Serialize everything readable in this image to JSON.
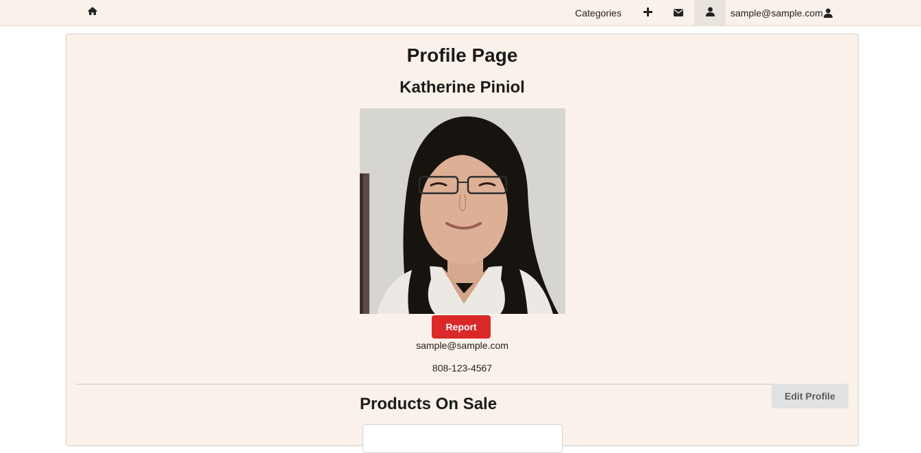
{
  "nav": {
    "home_icon": "home-icon",
    "categories_label": "Categories",
    "add_icon": "plus-icon",
    "mail_icon": "envelope-icon",
    "profile_icon": "user-icon",
    "user_email": "sample@sample.com",
    "user_icon": "user-icon"
  },
  "profile": {
    "page_title": "Profile Page",
    "name": "Katherine Piniol",
    "photo": "profile-photo",
    "report_label": "Report",
    "email": "sample@sample.com",
    "phone": "808-123-4567",
    "edit_label": "Edit Profile"
  },
  "products": {
    "section_title": "Products On Sale"
  },
  "colors": {
    "nav_bg": "#faf1ea",
    "card_bg": "#faf1ea",
    "report_red": "#db2828",
    "edit_grey": "#e0e1e2"
  }
}
